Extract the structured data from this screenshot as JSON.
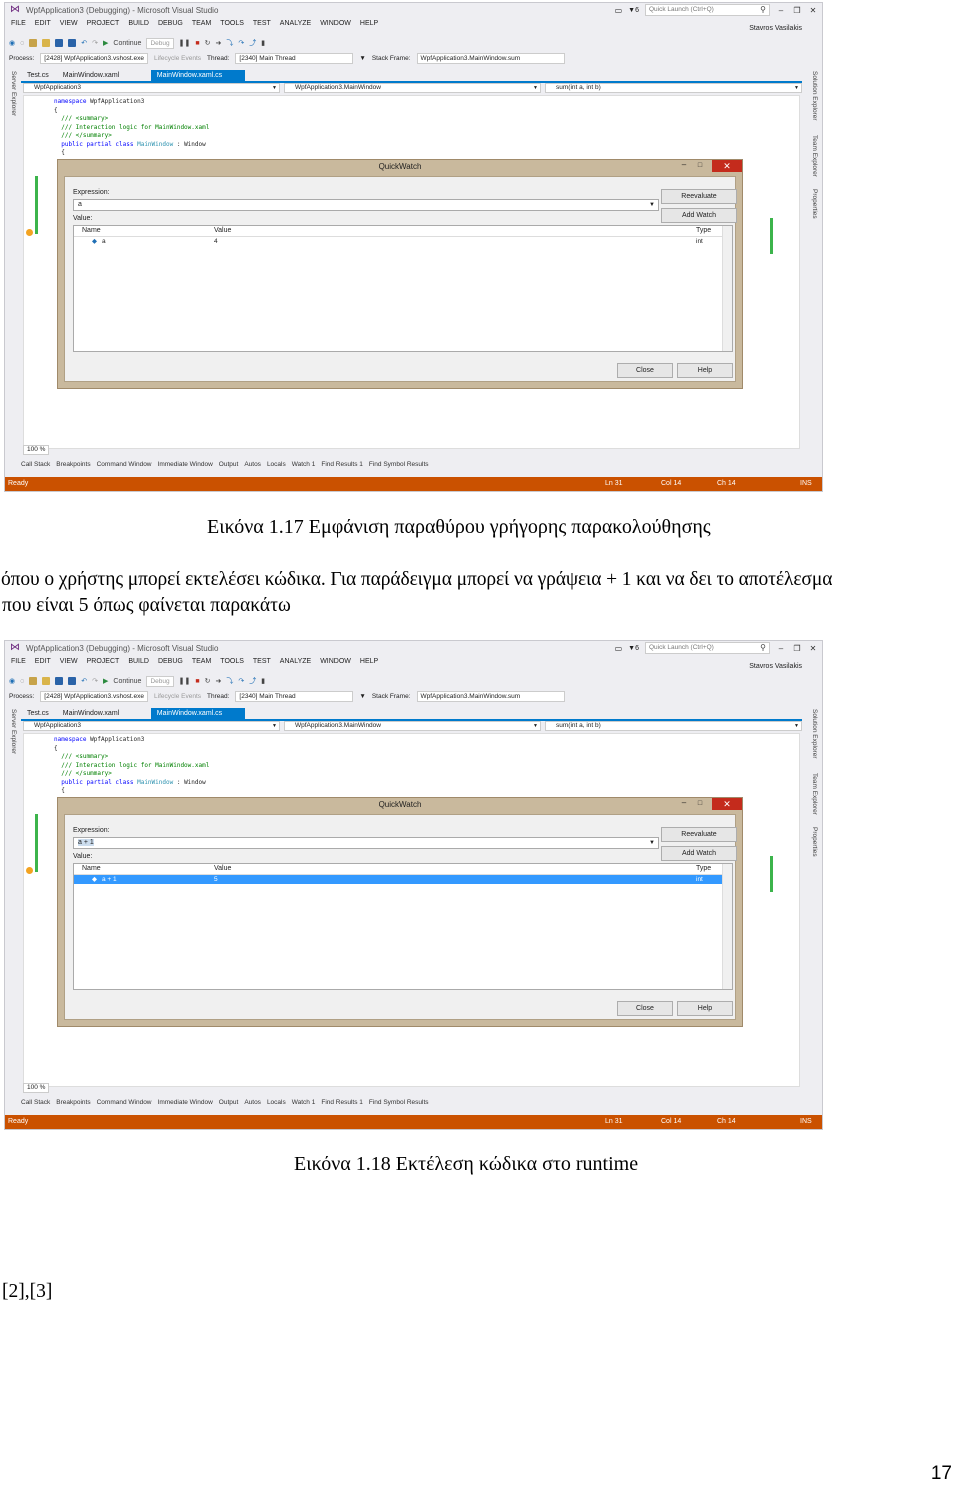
{
  "vs": {
    "window_title": "WpfApplication3 (Debugging) - Microsoft Visual Studio",
    "notification_count": "6",
    "quick_launch_placeholder": "Quick Launch (Ctrl+Q)",
    "user": "Stavros Vasilakis",
    "menu": [
      "FILE",
      "EDIT",
      "VIEW",
      "PROJECT",
      "BUILD",
      "DEBUG",
      "TEAM",
      "TOOLS",
      "TEST",
      "ANALYZE",
      "WINDOW",
      "HELP"
    ],
    "toolbar": {
      "continue": "Continue",
      "config": "Debug"
    },
    "toolbar2": {
      "process_label": "Process:",
      "process_value": "[2428] WpfApplication3.vshost.exe",
      "lifecycle": "Lifecycle Events",
      "thread_label": "Thread:",
      "thread_value": "[2340] Main Thread",
      "stack_label": "Stack Frame:",
      "stack_value": "WpfApplication3.MainWindow.sum"
    },
    "tabs": [
      "Test.cs",
      "MainWindow.xaml",
      "MainWindow.xaml.cs"
    ],
    "left_rail": "Server Explorer",
    "right_rail": [
      "Solution Explorer",
      "Team Explorer",
      "Properties"
    ],
    "nav": {
      "project": "WpfApplication3",
      "class": "WpfApplication3.MainWindow",
      "member": "sum(int a, int b)"
    },
    "code": {
      "l1_kw": "namespace",
      "l1_name": " WpfApplication3",
      "l2": "{",
      "l3": "/// <summary>",
      "l4": "/// Interaction logic for MainWindow.xaml",
      "l5": "/// </summary>",
      "l6_kw": "public partial class",
      "l6_type": " MainWindow",
      "l6_rest": " : Window",
      "l7": "{",
      "l8": "}"
    },
    "zoom": "100 %",
    "bottom_tabs": [
      "Call Stack",
      "Breakpoints",
      "Command Window",
      "Immediate Window",
      "Output",
      "Autos",
      "Locals",
      "Watch 1",
      "Find Results 1",
      "Find Symbol Results"
    ],
    "status": {
      "state": "Ready",
      "ln": "Ln 31",
      "col": "Col 14",
      "ch": "Ch 14",
      "ins": "INS"
    },
    "quickwatch": {
      "title": "QuickWatch",
      "expression_label": "Expression:",
      "value_label": "Value:",
      "reevaluate": "Reevaluate",
      "add_watch": "Add Watch",
      "col_name": "Name",
      "col_value": "Value",
      "col_type": "Type",
      "close": "Close",
      "help": "Help"
    }
  },
  "shot1": {
    "expression": "a",
    "row": {
      "name": "a",
      "value": "4",
      "type": "int"
    }
  },
  "shot2": {
    "expression": "a + 1",
    "row": {
      "name": "a + 1",
      "value": "5",
      "type": "int"
    }
  },
  "doc": {
    "caption1": "Εικόνα 1.17 Εμφάνιση παραθύρου γρήγορης παρακολούθησης",
    "para_line1": "όπου ο χρήστης μπορεί εκτελέσει κώδικα. Για παράδειγμα μπορεί να γράψεια + 1 και να δει το αποτέλεσμα",
    "para_line2": "που είναι 5 όπως φαίνεται παρακάτω",
    "caption2": "Εικόνα 1.18 Εκτέλεση κώδικα στο runtime",
    "refs": "[2],[3]",
    "page_number": "17"
  }
}
